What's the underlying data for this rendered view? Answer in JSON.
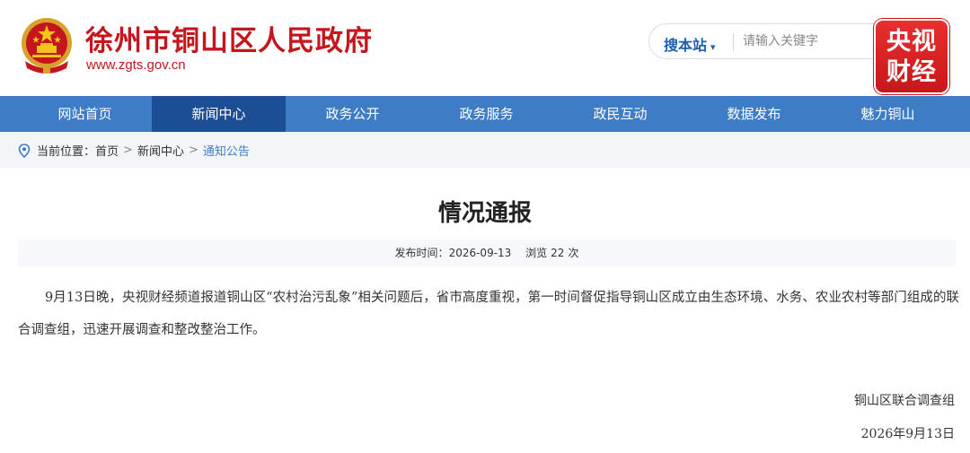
{
  "header": {
    "site_name": "徐州市铜山区人民政府",
    "site_url": "www.zgts.gov.cn",
    "emblem_icon": "national-emblem-icon",
    "brand_color": "#c4161c"
  },
  "search": {
    "scope_label": "搜本站",
    "placeholder": "请输入关键字"
  },
  "watermark": {
    "line1": "央视",
    "line2": "财经"
  },
  "nav": {
    "items": [
      {
        "label": "网站首页"
      },
      {
        "label": "新闻中心"
      },
      {
        "label": "政务公开"
      },
      {
        "label": "政务服务"
      },
      {
        "label": "政民互动"
      },
      {
        "label": "数据发布"
      },
      {
        "label": "魅力铜山"
      }
    ],
    "active_index": 1,
    "bg_color": "#3f7cc6",
    "active_color": "#1b4e95"
  },
  "breadcrumb": {
    "prefix": "当前位置：",
    "items": [
      "首页",
      "新闻中心",
      "通知公告"
    ],
    "separator": ">"
  },
  "article": {
    "title": "情况通报",
    "publish_label": "发布时间：",
    "publish_date": "2026-09-13",
    "views_label": "浏览",
    "views_count": "22",
    "views_unit": "次",
    "paragraph": "9月13日晚，央视财经频道报道铜山区“农村治污乱象”相关问题后，省市高度重视，第一时间督促指导铜山区成立由生态环境、水务、农业农村等部门组成的联合调查组，迅速开展调查和整改整治工作。",
    "signature": "铜山区联合调查组",
    "sign_date": "2026年9月13日"
  }
}
